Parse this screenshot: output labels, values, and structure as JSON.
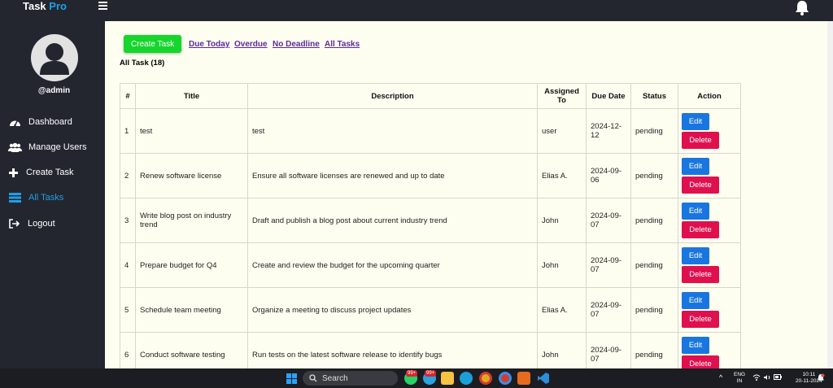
{
  "app": {
    "brand_main": "Task",
    "brand_accent": "Pro"
  },
  "user": {
    "username": "@admin"
  },
  "sidebar": {
    "items": [
      {
        "label": "Dashboard",
        "icon": "tachometer-icon",
        "active": false
      },
      {
        "label": "Manage Users",
        "icon": "users-icon",
        "active": false
      },
      {
        "label": "Create Task",
        "icon": "plus-icon",
        "active": false
      },
      {
        "label": "All Tasks",
        "icon": "tasks-icon",
        "active": true
      },
      {
        "label": "Logout",
        "icon": "logout-icon",
        "active": false
      }
    ]
  },
  "toolbar": {
    "create_label": "Create Task",
    "filters": [
      "Due Today",
      "Overdue",
      "No Deadline",
      "All Tasks"
    ]
  },
  "section_title": "All Task (18)",
  "table": {
    "headers": [
      "#",
      "Title",
      "Description",
      "Assigned To",
      "Due Date",
      "Status",
      "Action"
    ],
    "edit_label": "Edit",
    "delete_label": "Delete",
    "rows": [
      {
        "num": "1",
        "title": "test",
        "description": "test",
        "assigned": "user",
        "due": "2024-12-12",
        "status": "pending"
      },
      {
        "num": "2",
        "title": "Renew software license",
        "description": "Ensure all software licenses are renewed and up to date",
        "assigned": "Elias A.",
        "due": "2024-09-06",
        "status": "pending"
      },
      {
        "num": "3",
        "title": "Write blog post on industry trend",
        "description": "Draft and publish a blog post about current industry trend",
        "assigned": "John",
        "due": "2024-09-07",
        "status": "pending"
      },
      {
        "num": "4",
        "title": "Prepare budget for Q4",
        "description": "Create and review the budget for the upcoming quarter",
        "assigned": "John",
        "due": "2024-09-07",
        "status": "pending"
      },
      {
        "num": "5",
        "title": "Schedule team meeting",
        "description": "Organize a meeting to discuss project updates",
        "assigned": "Elias A.",
        "due": "2024-09-07",
        "status": "pending"
      },
      {
        "num": "6",
        "title": "Conduct software testing",
        "description": "Run tests on the latest software release to identify bugs",
        "assigned": "John",
        "due": "2024-09-07",
        "status": "pending"
      }
    ]
  },
  "taskbar": {
    "search_label": "Search",
    "badge_1": "99+",
    "badge_2": "99+",
    "lang_top": "ENG",
    "lang_bottom": "IN",
    "time": "10:11",
    "date": "20-11-2024"
  },
  "colors": {
    "sidebar_bg": "#23262f",
    "accent": "#1ea0e6",
    "content_bg": "#fefef0",
    "create_button": "#16d62c",
    "edit_button": "#1976e0",
    "delete_button": "#e0104f"
  }
}
